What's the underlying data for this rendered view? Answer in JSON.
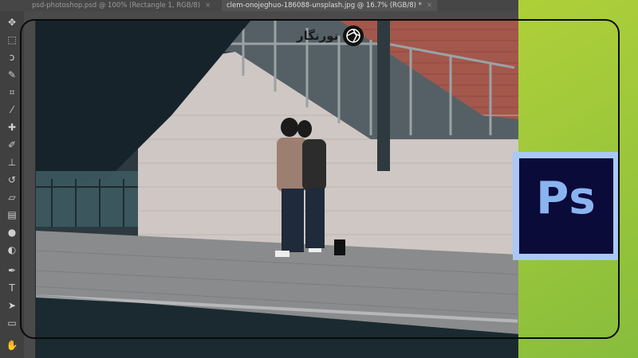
{
  "tabs": [
    {
      "label": "psd-photoshop.psd @ 100% (Rectangle 1, RGB/8)",
      "close": "×"
    },
    {
      "label": "clem-onojeghuo-186088-unsplash.jpg @ 16.7% (RGB/8) *",
      "close": "×"
    }
  ],
  "logo": {
    "text": "نورنگار"
  },
  "badge": {
    "text": "Ps"
  },
  "tools": [
    "move-icon",
    "marquee-icon",
    "lasso-icon",
    "quick-select-icon",
    "crop-icon",
    "eyedropper-icon",
    "healing-icon",
    "brush-icon",
    "stamp-icon",
    "history-brush-icon",
    "eraser-icon",
    "gradient-icon",
    "blur-icon",
    "dodge-icon",
    "pen-icon",
    "type-icon",
    "path-select-icon",
    "rectangle-icon",
    "hand-icon"
  ],
  "colors": {
    "green_light": "#b5d334",
    "green_dark": "#8fc13a",
    "accent_blue": "#8ab4f0",
    "badge_bg": "#0b0b3a"
  }
}
